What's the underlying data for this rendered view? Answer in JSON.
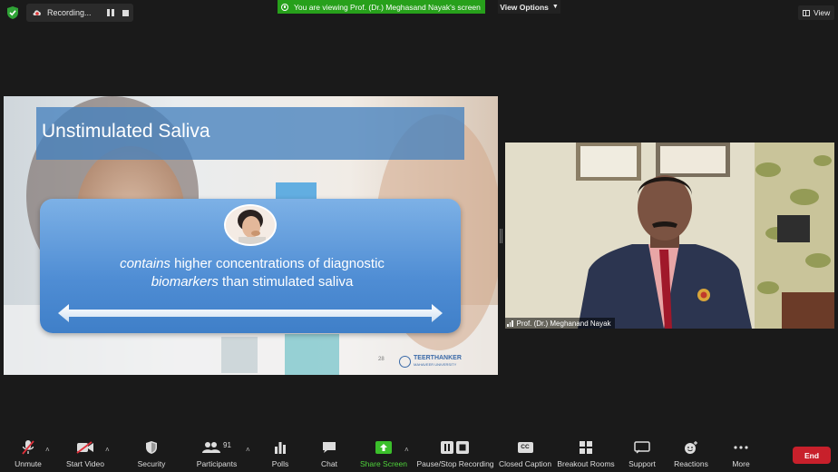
{
  "topbar": {
    "recording_label": "Recording...",
    "viewing_banner": "You are viewing Prof. (Dr.) Meghasand Nayak's screen",
    "view_options_label": "View Options",
    "view_label": "View"
  },
  "slide": {
    "title": "Unstimulated Saliva",
    "line1_em": "contains",
    "line1_rest": " higher concentrations of diagnostic",
    "line2_em": "biomarkers",
    "line2_rest": " than stimulated saliva",
    "slide_number": "28",
    "logo_text": "TEERTHANKER",
    "logo_sub": "MAHAVEER UNIVERSITY"
  },
  "participant": {
    "name": "Prof. (Dr.) Meghanand Nayak"
  },
  "toolbar": {
    "unmute": "Unmute",
    "start_video": "Start Video",
    "security": "Security",
    "participants": "Participants",
    "participant_count": "91",
    "polls": "Polls",
    "chat": "Chat",
    "share_screen": "Share Screen",
    "pause_stop_recording": "Pause/Stop Recording",
    "closed_caption": "Closed Caption",
    "cc_badge": "CC",
    "breakout_rooms": "Breakout Rooms",
    "support": "Support",
    "reactions": "Reactions",
    "more": "More",
    "end": "End"
  },
  "colors": {
    "banner_green": "#27a01b",
    "end_red": "#c8202b",
    "share_green": "#3bbf2b"
  }
}
